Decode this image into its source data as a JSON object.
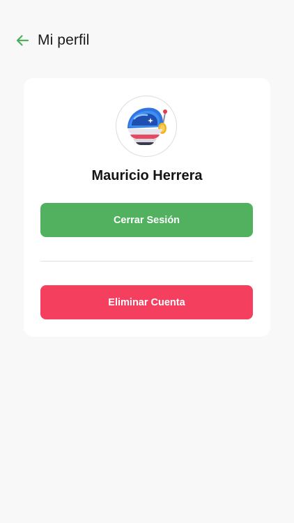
{
  "header": {
    "title": "Mi perfil",
    "back_icon": "arrow-left-icon"
  },
  "profile": {
    "avatar_icon": "astronaut-helmet-icon",
    "name": "Mauricio Herrera"
  },
  "actions": {
    "logout_label": "Cerrar Sesión",
    "delete_label": "Eliminar Cuenta"
  },
  "colors": {
    "accent_green": "#52b15f",
    "danger_red": "#f43f5e",
    "background": "#f8f8f8"
  }
}
